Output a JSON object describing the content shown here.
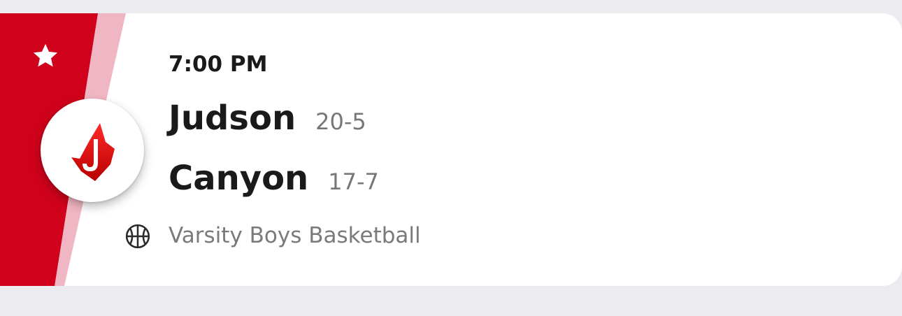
{
  "game": {
    "time": "7:00 PM",
    "home_team": {
      "name": "Judson",
      "record": "20-5",
      "logo_letter": "J",
      "logo_icon": "judson-j-logo"
    },
    "away_team": {
      "name": "Canyon",
      "record": "17-7"
    },
    "sport": {
      "label": "Varsity Boys Basketball",
      "icon": "basketball-icon"
    },
    "favorite_icon": "star-icon"
  },
  "colors": {
    "team_primary": "#d0021b",
    "team_secondary": "#f1b6c3",
    "card_background": "#ffffff",
    "page_background": "#ececf0"
  }
}
